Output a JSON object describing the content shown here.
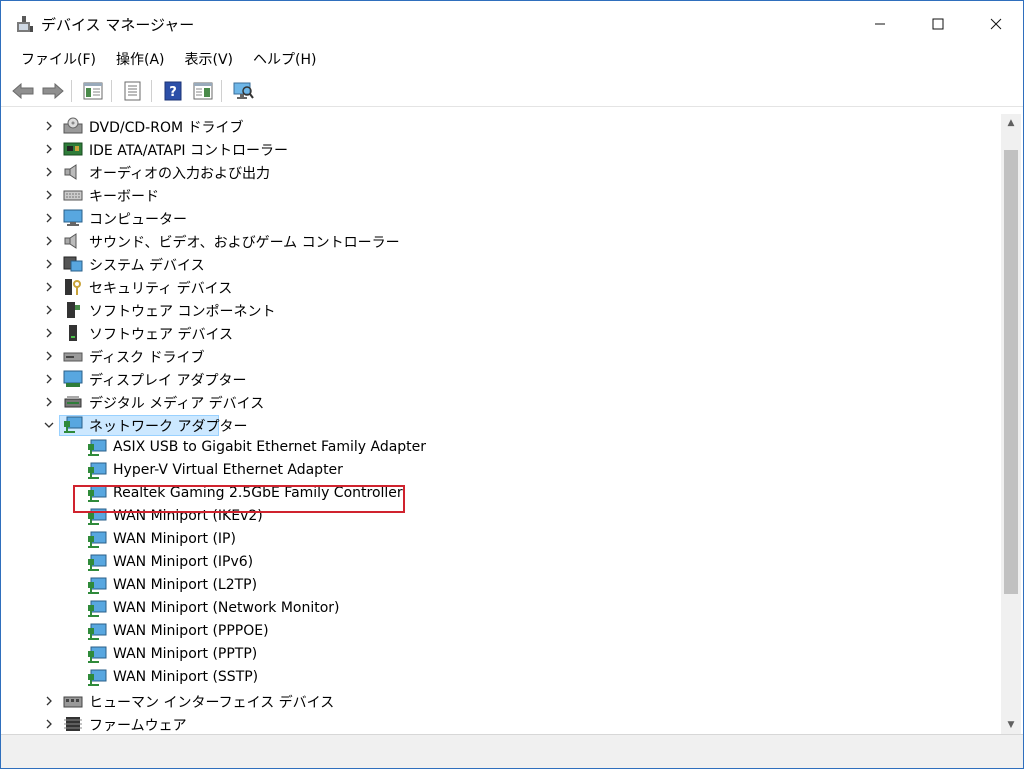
{
  "window": {
    "title": "デバイス マネージャー",
    "icon": "device-manager-icon",
    "controls": {
      "minimize": "—",
      "maximize": "☐",
      "close": "✕"
    }
  },
  "menu": [
    {
      "label": "ファイル(F)"
    },
    {
      "label": "操作(A)"
    },
    {
      "label": "表示(V)"
    },
    {
      "label": "ヘルプ(H)"
    }
  ],
  "toolbar": {
    "buttons": [
      "back-icon",
      "forward-icon",
      "console-tree-icon",
      "properties-icon",
      "help-icon",
      "action-pane-icon",
      "scan-hardware-icon"
    ]
  },
  "tree": {
    "categories_before": [
      {
        "label": "DVD/CD-ROM ドライブ",
        "icon": "dvd-drive-icon"
      },
      {
        "label": "IDE ATA/ATAPI コントローラー",
        "icon": "ide-controller-icon"
      },
      {
        "label": "オーディオの入力および出力",
        "icon": "speaker-icon"
      },
      {
        "label": "キーボード",
        "icon": "keyboard-icon"
      },
      {
        "label": "コンピューター",
        "icon": "computer-icon"
      },
      {
        "label": "サウンド、ビデオ、およびゲーム コントローラー",
        "icon": "speaker-icon"
      },
      {
        "label": "システム デバイス",
        "icon": "system-device-icon"
      },
      {
        "label": "セキュリティ デバイス",
        "icon": "security-device-icon"
      },
      {
        "label": "ソフトウェア コンポーネント",
        "icon": "software-component-icon"
      },
      {
        "label": "ソフトウェア デバイス",
        "icon": "software-device-icon"
      },
      {
        "label": "ディスク ドライブ",
        "icon": "disk-drive-icon"
      },
      {
        "label": "ディスプレイ アダプター",
        "icon": "display-adapter-icon"
      },
      {
        "label": "デジタル メディア デバイス",
        "icon": "media-device-icon"
      }
    ],
    "expanded_category": {
      "label": "ネットワーク アダプター",
      "icon": "network-adapter-icon"
    },
    "network_adapters": [
      "ASIX USB to Gigabit Ethernet Family Adapter",
      "Hyper-V Virtual Ethernet Adapter",
      "Realtek Gaming 2.5GbE Family Controller",
      "WAN Miniport (IKEv2)",
      "WAN Miniport (IP)",
      "WAN Miniport (IPv6)",
      "WAN Miniport (L2TP)",
      "WAN Miniport (Network Monitor)",
      "WAN Miniport (PPPOE)",
      "WAN Miniport (PPTP)",
      "WAN Miniport (SSTP)"
    ],
    "categories_after": [
      {
        "label": "ヒューマン インターフェイス デバイス",
        "icon": "hid-icon"
      },
      {
        "label": "ファームウェア",
        "icon": "firmware-icon"
      }
    ],
    "highlighted_item": "Realtek Gaming 2.5GbE Family Controller"
  },
  "colors": {
    "accent_border": "#2f6fbd",
    "selection": "#cce8ff",
    "highlight_box": "#d0232e"
  }
}
